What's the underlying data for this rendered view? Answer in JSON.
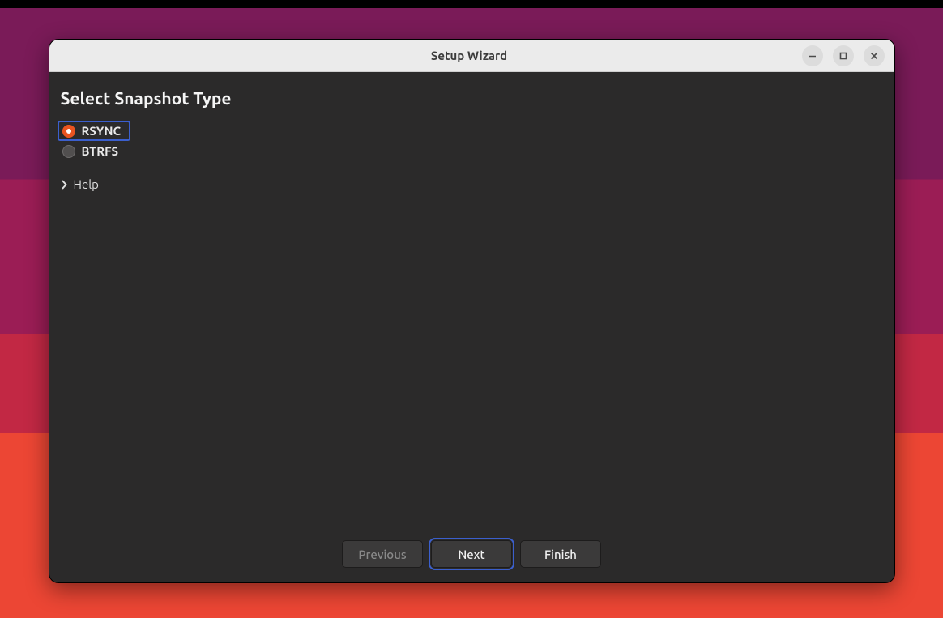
{
  "window": {
    "title": "Setup Wizard"
  },
  "page": {
    "title": "Select Snapshot Type"
  },
  "options": {
    "rsync": {
      "label": "RSYNC",
      "selected": true,
      "focused": true
    },
    "btrfs": {
      "label": "BTRFS",
      "selected": false,
      "focused": false
    }
  },
  "help": {
    "label": "Help",
    "expanded": false
  },
  "buttons": {
    "previous": {
      "label": "Previous",
      "enabled": false,
      "focused": false
    },
    "next": {
      "label": "Next",
      "enabled": true,
      "focused": true
    },
    "finish": {
      "label": "Finish",
      "enabled": true,
      "focused": false
    }
  }
}
